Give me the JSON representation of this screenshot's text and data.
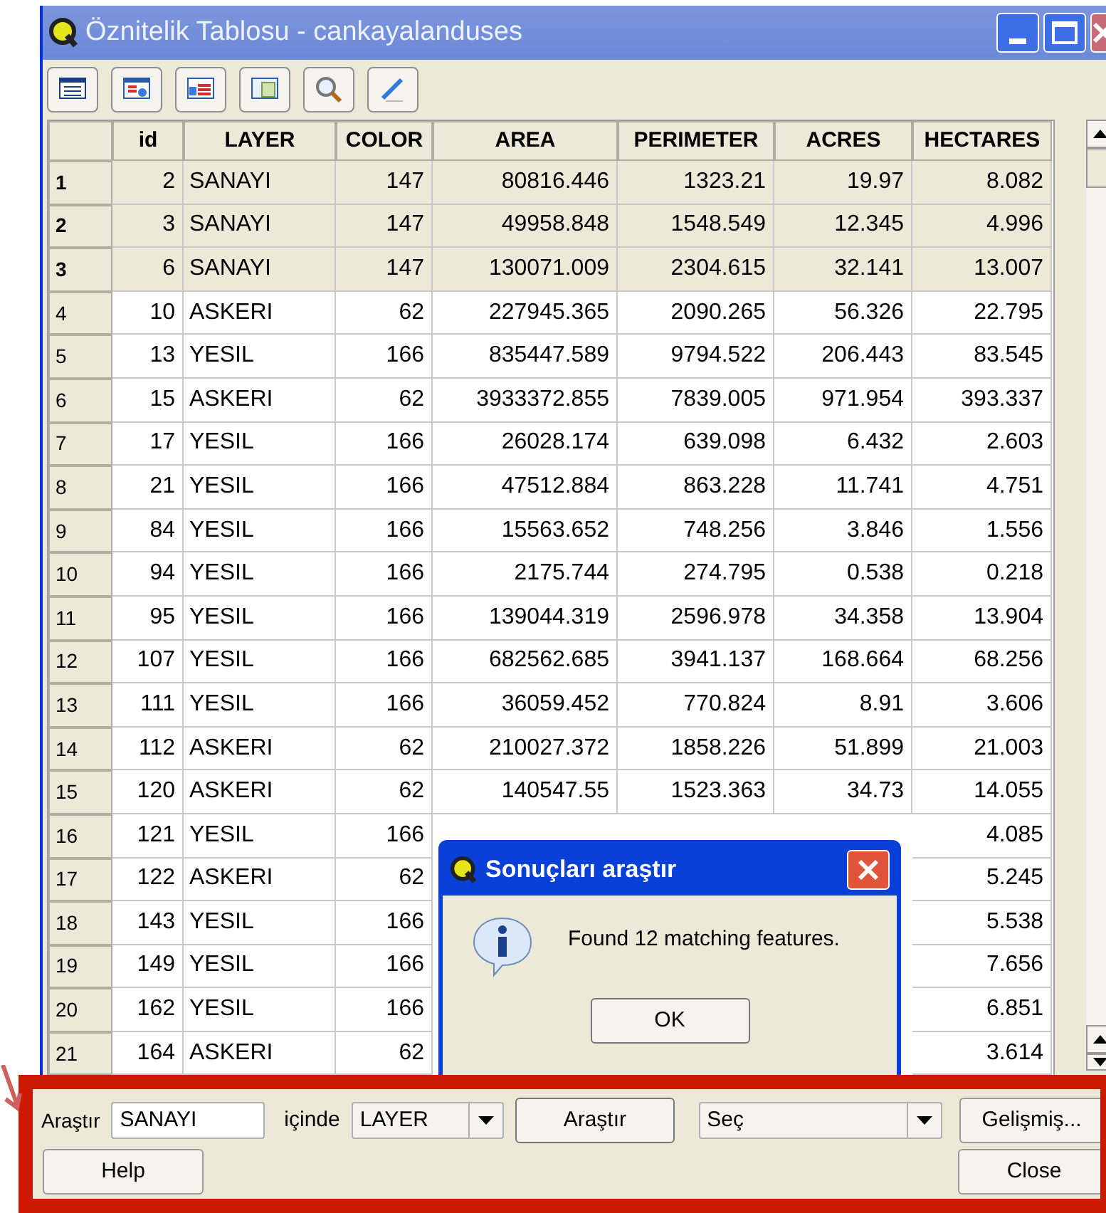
{
  "window": {
    "title": "Öznitelik Tablosu - cankayalanduses"
  },
  "table": {
    "columns": [
      "id",
      "LAYER",
      "COLOR",
      "AREA",
      "PERIMETER",
      "ACRES",
      "HECTARES"
    ],
    "rows": [
      {
        "number": "1",
        "selected": true,
        "cells": [
          "2",
          "SANAYI",
          "147",
          "80816.446",
          "1323.21",
          "19.97",
          "8.082"
        ]
      },
      {
        "number": "2",
        "selected": true,
        "cells": [
          "3",
          "SANAYI",
          "147",
          "49958.848",
          "1548.549",
          "12.345",
          "4.996"
        ]
      },
      {
        "number": "3",
        "selected": true,
        "cells": [
          "6",
          "SANAYI",
          "147",
          "130071.009",
          "2304.615",
          "32.141",
          "13.007"
        ]
      },
      {
        "number": "4",
        "selected": false,
        "cells": [
          "10",
          "ASKERI",
          "62",
          "227945.365",
          "2090.265",
          "56.326",
          "22.795"
        ]
      },
      {
        "number": "5",
        "selected": false,
        "cells": [
          "13",
          "YESIL",
          "166",
          "835447.589",
          "9794.522",
          "206.443",
          "83.545"
        ]
      },
      {
        "number": "6",
        "selected": false,
        "cells": [
          "15",
          "ASKERI",
          "62",
          "3933372.855",
          "7839.005",
          "971.954",
          "393.337"
        ]
      },
      {
        "number": "7",
        "selected": false,
        "cells": [
          "17",
          "YESIL",
          "166",
          "26028.174",
          "639.098",
          "6.432",
          "2.603"
        ]
      },
      {
        "number": "8",
        "selected": false,
        "cells": [
          "21",
          "YESIL",
          "166",
          "47512.884",
          "863.228",
          "11.741",
          "4.751"
        ]
      },
      {
        "number": "9",
        "selected": false,
        "cells": [
          "84",
          "YESIL",
          "166",
          "15563.652",
          "748.256",
          "3.846",
          "1.556"
        ]
      },
      {
        "number": "10",
        "selected": false,
        "cells": [
          "94",
          "YESIL",
          "166",
          "2175.744",
          "274.795",
          "0.538",
          "0.218"
        ]
      },
      {
        "number": "11",
        "selected": false,
        "cells": [
          "95",
          "YESIL",
          "166",
          "139044.319",
          "2596.978",
          "34.358",
          "13.904"
        ]
      },
      {
        "number": "12",
        "selected": false,
        "cells": [
          "107",
          "YESIL",
          "166",
          "682562.685",
          "3941.137",
          "168.664",
          "68.256"
        ]
      },
      {
        "number": "13",
        "selected": false,
        "cells": [
          "111",
          "YESIL",
          "166",
          "36059.452",
          "770.824",
          "8.91",
          "3.606"
        ]
      },
      {
        "number": "14",
        "selected": false,
        "cells": [
          "112",
          "ASKERI",
          "62",
          "210027.372",
          "1858.226",
          "51.899",
          "21.003"
        ]
      },
      {
        "number": "15",
        "selected": false,
        "cells": [
          "120",
          "ASKERI",
          "62",
          "140547.55",
          "1523.363",
          "34.73",
          "14.055"
        ]
      },
      {
        "number": "16",
        "selected": false,
        "cells": [
          "121",
          "YESIL",
          "166",
          null,
          null,
          null,
          "4.085"
        ]
      },
      {
        "number": "17",
        "selected": false,
        "cells": [
          "122",
          "ASKERI",
          "62",
          null,
          null,
          null,
          "5.245"
        ]
      },
      {
        "number": "18",
        "selected": false,
        "cells": [
          "143",
          "YESIL",
          "166",
          null,
          null,
          null,
          "5.538"
        ]
      },
      {
        "number": "19",
        "selected": false,
        "cells": [
          "149",
          "YESIL",
          "166",
          null,
          null,
          null,
          "7.656"
        ]
      },
      {
        "number": "20",
        "selected": false,
        "cells": [
          "162",
          "YESIL",
          "166",
          null,
          null,
          null,
          "6.851"
        ]
      },
      {
        "number": "21",
        "selected": false,
        "cells": [
          "164",
          "ASKERI",
          "62",
          null,
          null,
          null,
          "3.614"
        ]
      }
    ]
  },
  "dialog": {
    "title": "Sonuçları araştır",
    "message": "Found 12 matching features.",
    "button": "OK"
  },
  "search_bar": {
    "label": "Araştır",
    "value": "SANAYI",
    "in_label": "içinde",
    "field": "LAYER",
    "search_button": "Araştır",
    "mode": "Seç",
    "advanced_button": "Gelişmiş...",
    "help_button": "Help",
    "close_button": "Close"
  }
}
